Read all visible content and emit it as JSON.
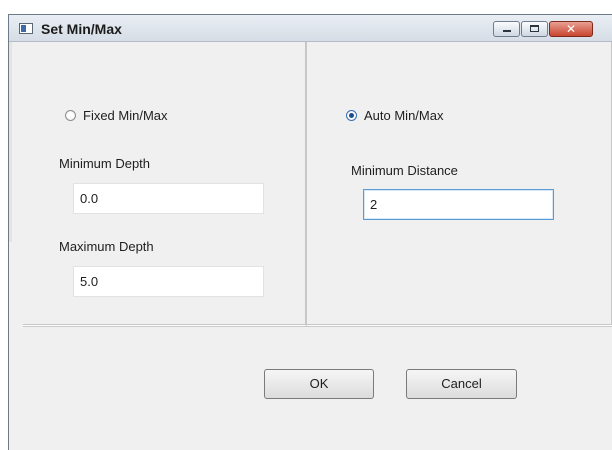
{
  "window": {
    "title": "Set Min/Max"
  },
  "titlebar_buttons": {
    "close_glyph": "✕"
  },
  "left_pane": {
    "mode_label": "Fixed Min/Max",
    "mode_selected": false,
    "min_depth_label": "Minimum Depth",
    "min_depth_value": "0.0",
    "max_depth_label": "Maximum Depth",
    "max_depth_value": "5.0"
  },
  "right_pane": {
    "mode_label": "Auto Min/Max",
    "mode_selected": true,
    "min_distance_label": "Minimum Distance",
    "min_distance_value": "2"
  },
  "buttons": {
    "ok_label": "OK",
    "cancel_label": "Cancel"
  }
}
